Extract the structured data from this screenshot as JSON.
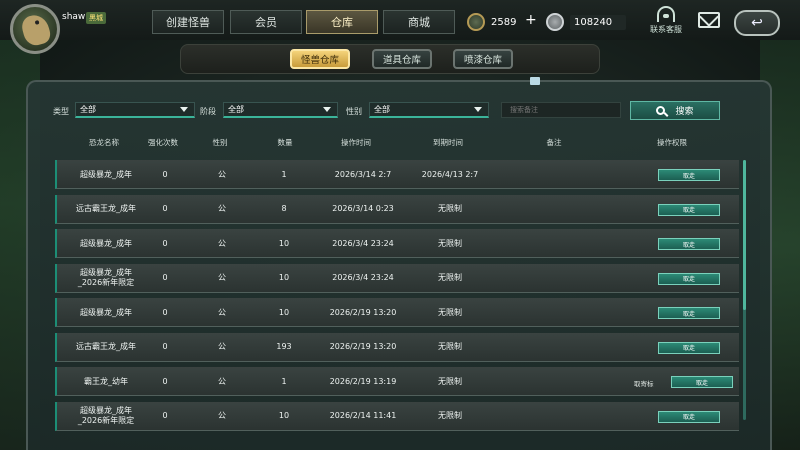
{
  "user": {
    "name": "shaw",
    "vip_label": "黑城"
  },
  "nav": {
    "tabs": [
      {
        "label": "创建怪兽"
      },
      {
        "label": "会员"
      },
      {
        "label": "仓库",
        "active": true
      },
      {
        "label": "商城"
      }
    ]
  },
  "currency": {
    "coins": "2589",
    "plus": "+",
    "silver": "108240"
  },
  "support": {
    "label": "联系客服"
  },
  "subtabs": [
    {
      "label": "怪兽仓库",
      "active": true
    },
    {
      "label": "道具仓库"
    },
    {
      "label": "喷漆仓库"
    }
  ],
  "filters": {
    "type_label": "类型",
    "type_value": "全部",
    "stage_label": "阶段",
    "stage_value": "全部",
    "gender_label": "性别",
    "gender_value": "全部",
    "remark_placeholder": "搜索备注",
    "search_label": "搜索"
  },
  "table": {
    "headers": [
      "恐龙名称",
      "强化次数",
      "性别",
      "数量",
      "操作时间",
      "到期时间",
      "备注",
      "操作权限"
    ],
    "rows": [
      {
        "name": "超级暴龙_成年",
        "enhance": "0",
        "gender": "公",
        "qty": "1",
        "op_time": "2026/3/14 2:7",
        "expire": "2026/4/13 2:7",
        "remark": "",
        "action": "取走"
      },
      {
        "name": "远古霸王龙_成年",
        "enhance": "0",
        "gender": "公",
        "qty": "8",
        "op_time": "2026/3/14 0:23",
        "expire": "无限制",
        "remark": "",
        "action": "取走"
      },
      {
        "name": "超级暴龙_成年",
        "enhance": "0",
        "gender": "公",
        "qty": "10",
        "op_time": "2026/3/4 23:24",
        "expire": "无限制",
        "remark": "",
        "action": "取走"
      },
      {
        "name": "超级暴龙_成年_2026新年限定",
        "enhance": "0",
        "gender": "公",
        "qty": "10",
        "op_time": "2026/3/4 23:24",
        "expire": "无限制",
        "remark": "",
        "action": "取走"
      },
      {
        "name": "超级暴龙_成年",
        "enhance": "0",
        "gender": "公",
        "qty": "10",
        "op_time": "2026/2/19 13:20",
        "expire": "无限制",
        "remark": "",
        "action": "取走"
      },
      {
        "name": "远古霸王龙_成年",
        "enhance": "0",
        "gender": "公",
        "qty": "193",
        "op_time": "2026/2/19 13:20",
        "expire": "无限制",
        "remark": "",
        "action": "取走"
      },
      {
        "name": "霸王龙_幼年",
        "enhance": "0",
        "gender": "公",
        "qty": "1",
        "op_time": "2026/2/19 13:19",
        "expire": "无限制",
        "remark": "",
        "action": "取走",
        "extra": "取寄标"
      },
      {
        "name": "超级暴龙_成年_2026新年限定",
        "enhance": "0",
        "gender": "公",
        "qty": "10",
        "op_time": "2026/2/14 11:41",
        "expire": "无限制",
        "remark": "",
        "action": "取走"
      }
    ]
  }
}
